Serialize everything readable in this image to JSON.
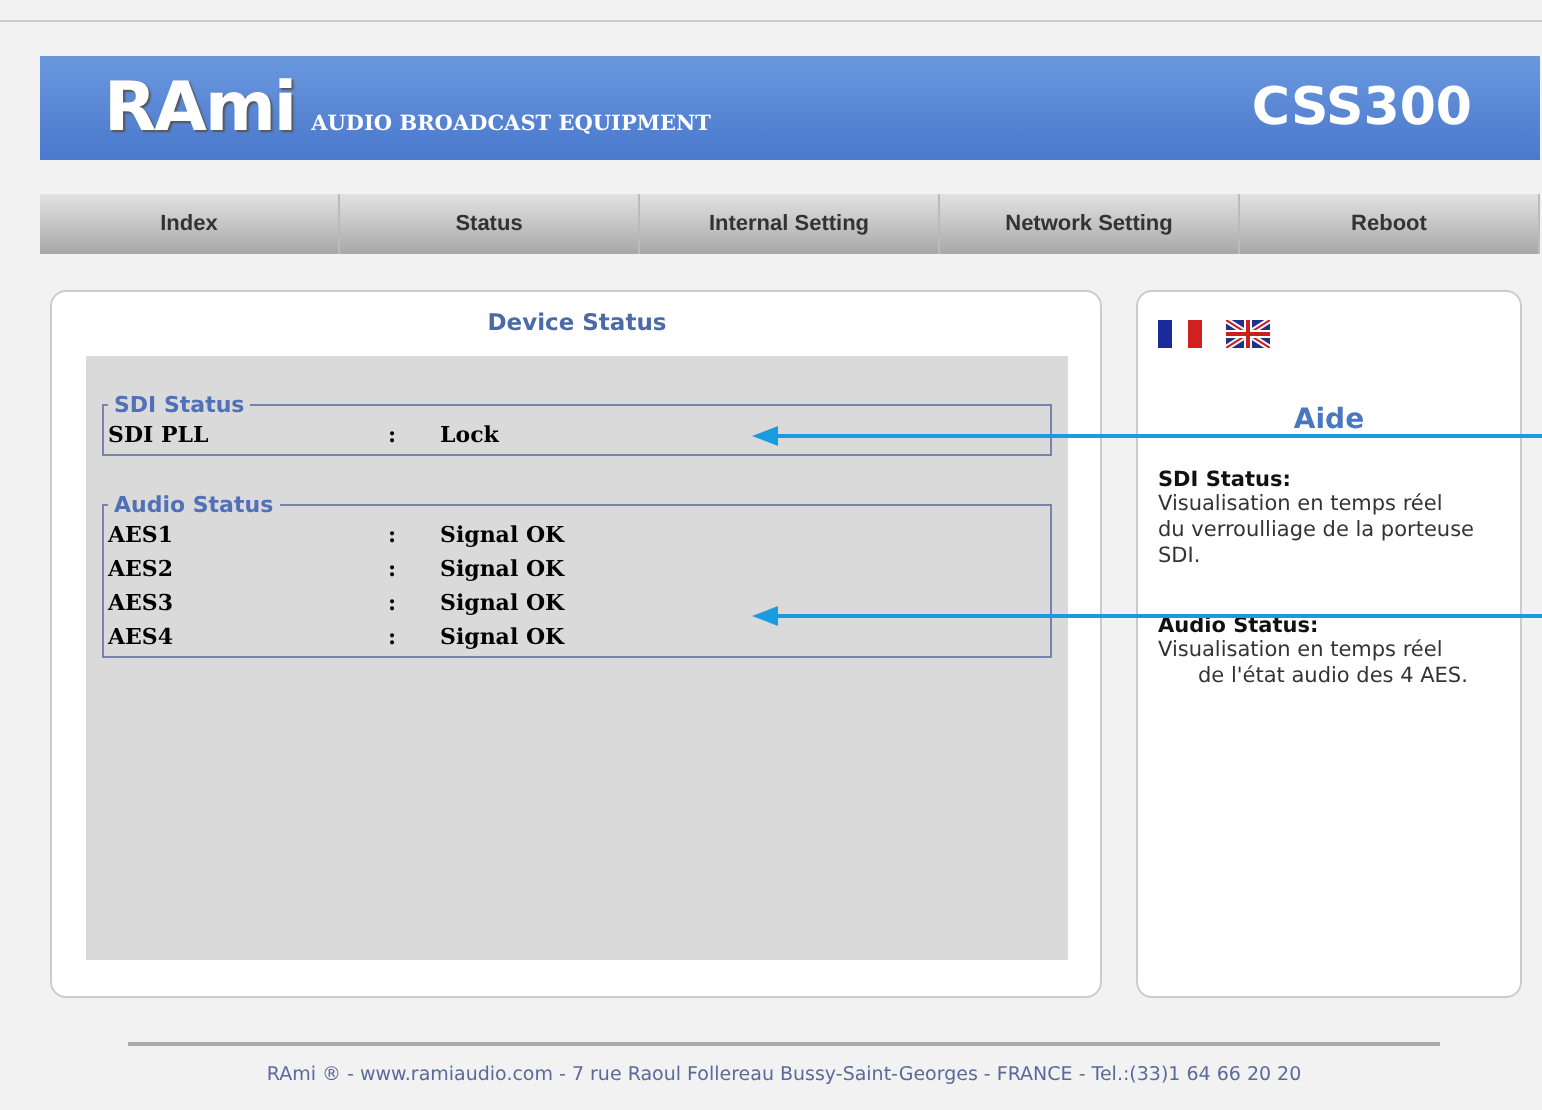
{
  "header": {
    "logo": "RAmi",
    "tagline": "AUDIO BROADCAST EQUIPMENT",
    "model": "CSS300"
  },
  "nav": [
    {
      "label": "Index"
    },
    {
      "label": "Status"
    },
    {
      "label": "Internal Setting"
    },
    {
      "label": "Network Setting"
    },
    {
      "label": "Reboot"
    }
  ],
  "device_status": {
    "title": "Device Status",
    "groups": [
      {
        "legend": "SDI Status",
        "rows": [
          {
            "name": "SDI PLL",
            "separator": ":",
            "value": "Lock"
          }
        ]
      },
      {
        "legend": "Audio Status",
        "rows": [
          {
            "name": "AES1",
            "separator": ":",
            "value": "Signal OK"
          },
          {
            "name": "AES2",
            "separator": ":",
            "value": "Signal OK"
          },
          {
            "name": "AES3",
            "separator": ":",
            "value": "Signal OK"
          },
          {
            "name": "AES4",
            "separator": ":",
            "value": "Signal OK"
          }
        ]
      }
    ]
  },
  "help": {
    "title": "Aide",
    "sections": [
      {
        "heading": "SDI Status:",
        "lines": [
          {
            "text": "Visualisation en temps réel",
            "indented": false
          },
          {
            "text": "du verroulliage de la porteuse",
            "indented": false
          },
          {
            "text": "SDI.",
            "indented": false
          }
        ]
      },
      {
        "heading": "Audio Status:",
        "lines": [
          {
            "text": "Visualisation en temps réel",
            "indented": false
          },
          {
            "text": "de l'état audio des 4 AES.",
            "indented": true
          }
        ]
      }
    ]
  },
  "footer": "RAmi ® - www.ramiaudio.com - 7 rue Raoul Follereau Bussy-Saint-Georges - FRANCE - Tel.:(33)1 64 66 20 20"
}
